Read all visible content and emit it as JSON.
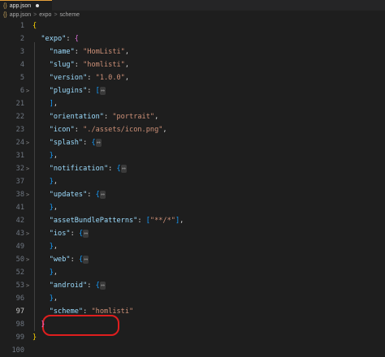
{
  "tab": {
    "icon": "{}",
    "label": "app.json"
  },
  "breadcrumb": {
    "icon": "{}",
    "file": "app.json",
    "sep": ">",
    "item1": "expo",
    "item2": "scheme"
  },
  "lines": [
    {
      "n": "1",
      "fold": "",
      "t": [
        [
          "b1",
          "{"
        ]
      ]
    },
    {
      "n": "2",
      "fold": "",
      "t": [
        [
          "ind",
          "  "
        ],
        [
          "k",
          "\"expo\""
        ],
        [
          "p",
          ": "
        ],
        [
          "b2",
          "{"
        ]
      ]
    },
    {
      "n": "3",
      "fold": "",
      "t": [
        [
          "ind",
          "    "
        ],
        [
          "k",
          "\"name\""
        ],
        [
          "p",
          ": "
        ],
        [
          "s",
          "\"HomListi\""
        ],
        [
          "p",
          ","
        ]
      ]
    },
    {
      "n": "4",
      "fold": "",
      "t": [
        [
          "ind",
          "    "
        ],
        [
          "k",
          "\"slug\""
        ],
        [
          "p",
          ": "
        ],
        [
          "s",
          "\"homlisti\""
        ],
        [
          "p",
          ","
        ]
      ]
    },
    {
      "n": "5",
      "fold": "",
      "t": [
        [
          "ind",
          "    "
        ],
        [
          "k",
          "\"version\""
        ],
        [
          "p",
          ": "
        ],
        [
          "s",
          "\"1.0.0\""
        ],
        [
          "p",
          ","
        ]
      ]
    },
    {
      "n": "6",
      "fold": ">",
      "t": [
        [
          "ind",
          "    "
        ],
        [
          "k",
          "\"plugins\""
        ],
        [
          "p",
          ": "
        ],
        [
          "b3",
          "["
        ],
        [
          "ell",
          "↔"
        ]
      ]
    },
    {
      "n": "21",
      "fold": "",
      "t": [
        [
          "ind",
          "    "
        ],
        [
          "b3",
          "]"
        ],
        [
          "p",
          ","
        ]
      ]
    },
    {
      "n": "22",
      "fold": "",
      "t": [
        [
          "ind",
          "    "
        ],
        [
          "k",
          "\"orientation\""
        ],
        [
          "p",
          ": "
        ],
        [
          "s",
          "\"portrait\""
        ],
        [
          "p",
          ","
        ]
      ]
    },
    {
      "n": "23",
      "fold": "",
      "t": [
        [
          "ind",
          "    "
        ],
        [
          "k",
          "\"icon\""
        ],
        [
          "p",
          ": "
        ],
        [
          "s",
          "\"./assets/icon.png\""
        ],
        [
          "p",
          ","
        ]
      ]
    },
    {
      "n": "24",
      "fold": ">",
      "t": [
        [
          "ind",
          "    "
        ],
        [
          "k",
          "\"splash\""
        ],
        [
          "p",
          ": "
        ],
        [
          "b3",
          "{"
        ],
        [
          "ell",
          "↔"
        ]
      ]
    },
    {
      "n": "31",
      "fold": "",
      "t": [
        [
          "ind",
          "    "
        ],
        [
          "b3",
          "}"
        ],
        [
          "p",
          ","
        ]
      ]
    },
    {
      "n": "32",
      "fold": ">",
      "t": [
        [
          "ind",
          "    "
        ],
        [
          "k",
          "\"notification\""
        ],
        [
          "p",
          ": "
        ],
        [
          "b3",
          "{"
        ],
        [
          "ell",
          "↔"
        ]
      ]
    },
    {
      "n": "37",
      "fold": "",
      "t": [
        [
          "ind",
          "    "
        ],
        [
          "b3",
          "}"
        ],
        [
          "p",
          ","
        ]
      ]
    },
    {
      "n": "38",
      "fold": ">",
      "t": [
        [
          "ind",
          "    "
        ],
        [
          "k",
          "\"updates\""
        ],
        [
          "p",
          ": "
        ],
        [
          "b3",
          "{"
        ],
        [
          "ell",
          "↔"
        ]
      ]
    },
    {
      "n": "41",
      "fold": "",
      "t": [
        [
          "ind",
          "    "
        ],
        [
          "b3",
          "}"
        ],
        [
          "p",
          ","
        ]
      ]
    },
    {
      "n": "42",
      "fold": "",
      "t": [
        [
          "ind",
          "    "
        ],
        [
          "k",
          "\"assetBundlePatterns\""
        ],
        [
          "p",
          ": "
        ],
        [
          "b3",
          "["
        ],
        [
          "s",
          "\"**/*\""
        ],
        [
          "b3",
          "]"
        ],
        [
          "p",
          ","
        ]
      ]
    },
    {
      "n": "43",
      "fold": ">",
      "t": [
        [
          "ind",
          "    "
        ],
        [
          "k",
          "\"ios\""
        ],
        [
          "p",
          ": "
        ],
        [
          "b3",
          "{"
        ],
        [
          "ell",
          "↔"
        ]
      ]
    },
    {
      "n": "49",
      "fold": "",
      "t": [
        [
          "ind",
          "    "
        ],
        [
          "b3",
          "}"
        ],
        [
          "p",
          ","
        ]
      ]
    },
    {
      "n": "50",
      "fold": ">",
      "t": [
        [
          "ind",
          "    "
        ],
        [
          "k",
          "\"web\""
        ],
        [
          "p",
          ": "
        ],
        [
          "b3",
          "{"
        ],
        [
          "ell",
          "↔"
        ]
      ]
    },
    {
      "n": "52",
      "fold": "",
      "t": [
        [
          "ind",
          "    "
        ],
        [
          "b3",
          "}"
        ],
        [
          "p",
          ","
        ]
      ]
    },
    {
      "n": "53",
      "fold": ">",
      "t": [
        [
          "ind",
          "    "
        ],
        [
          "k",
          "\"android\""
        ],
        [
          "p",
          ": "
        ],
        [
          "b3",
          "{"
        ],
        [
          "ell",
          "↔"
        ]
      ]
    },
    {
      "n": "96",
      "fold": "",
      "t": [
        [
          "ind",
          "    "
        ],
        [
          "b3",
          "}"
        ],
        [
          "p",
          ","
        ]
      ]
    },
    {
      "n": "97",
      "fold": "",
      "active": true,
      "t": [
        [
          "ind",
          "    "
        ],
        [
          "k",
          "\"scheme\""
        ],
        [
          "p",
          ": "
        ],
        [
          "s",
          "\"homlisti\""
        ]
      ]
    },
    {
      "n": "98",
      "fold": "",
      "t": [
        [
          "ind",
          "  "
        ],
        [
          "b2",
          "}"
        ]
      ]
    },
    {
      "n": "99",
      "fold": "",
      "t": [
        [
          "b1",
          "}"
        ]
      ]
    },
    {
      "n": "100",
      "fold": "",
      "t": []
    }
  ]
}
